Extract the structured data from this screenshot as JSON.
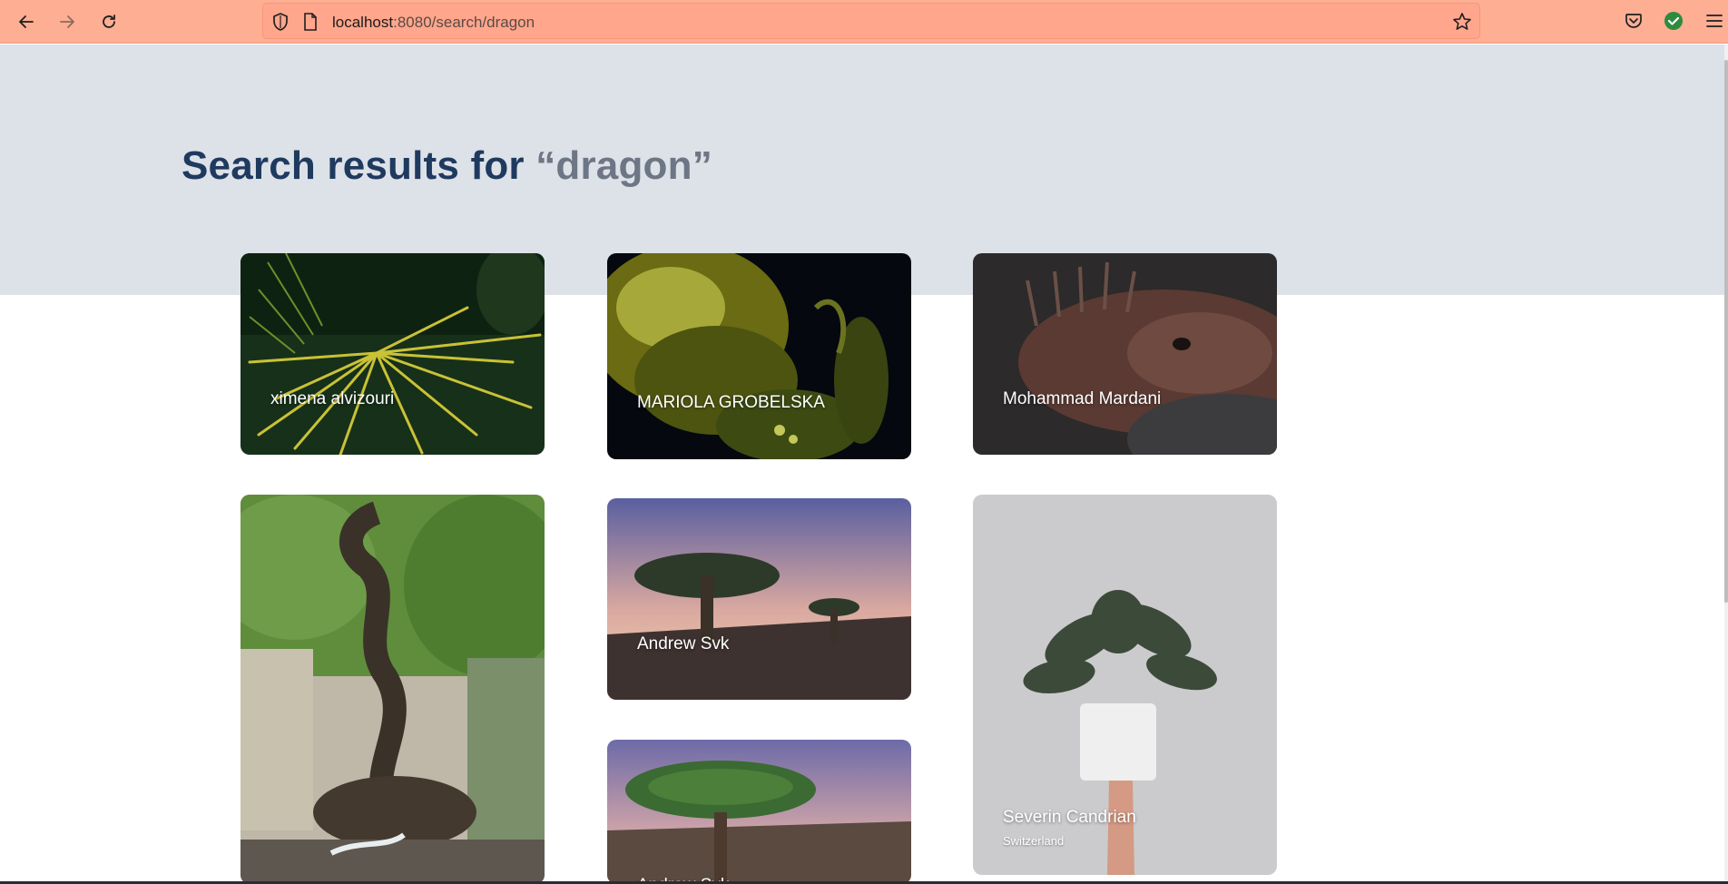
{
  "browser": {
    "url_host": "localhost",
    "url_rest": ":8080/search/dragon",
    "icons": [
      "back-arrow-icon",
      "forward-arrow-icon",
      "reload-icon",
      "shield-icon",
      "page-icon",
      "star-icon",
      "pocket-icon",
      "extension-check-icon",
      "menu-icon"
    ]
  },
  "page": {
    "title_prefix": "Search results for ",
    "title_query": "“dragon”"
  },
  "results": [
    {
      "name": "ximena alvizouri",
      "location": ""
    },
    {
      "name": "MARIOLA GROBELSKA",
      "location": ""
    },
    {
      "name": "Mohammad Mardani",
      "location": ""
    },
    {
      "name": "",
      "location": ""
    },
    {
      "name": "Andrew Svk",
      "location": ""
    },
    {
      "name": "Severin Candrian",
      "location": "Switzerland"
    },
    {
      "name": "Andrew Svk",
      "location": ""
    }
  ],
  "colors": {
    "toolbar": "#fdae93",
    "hero": "#dde1e8",
    "title": "#1f3a5f",
    "query": "#6d7684"
  }
}
